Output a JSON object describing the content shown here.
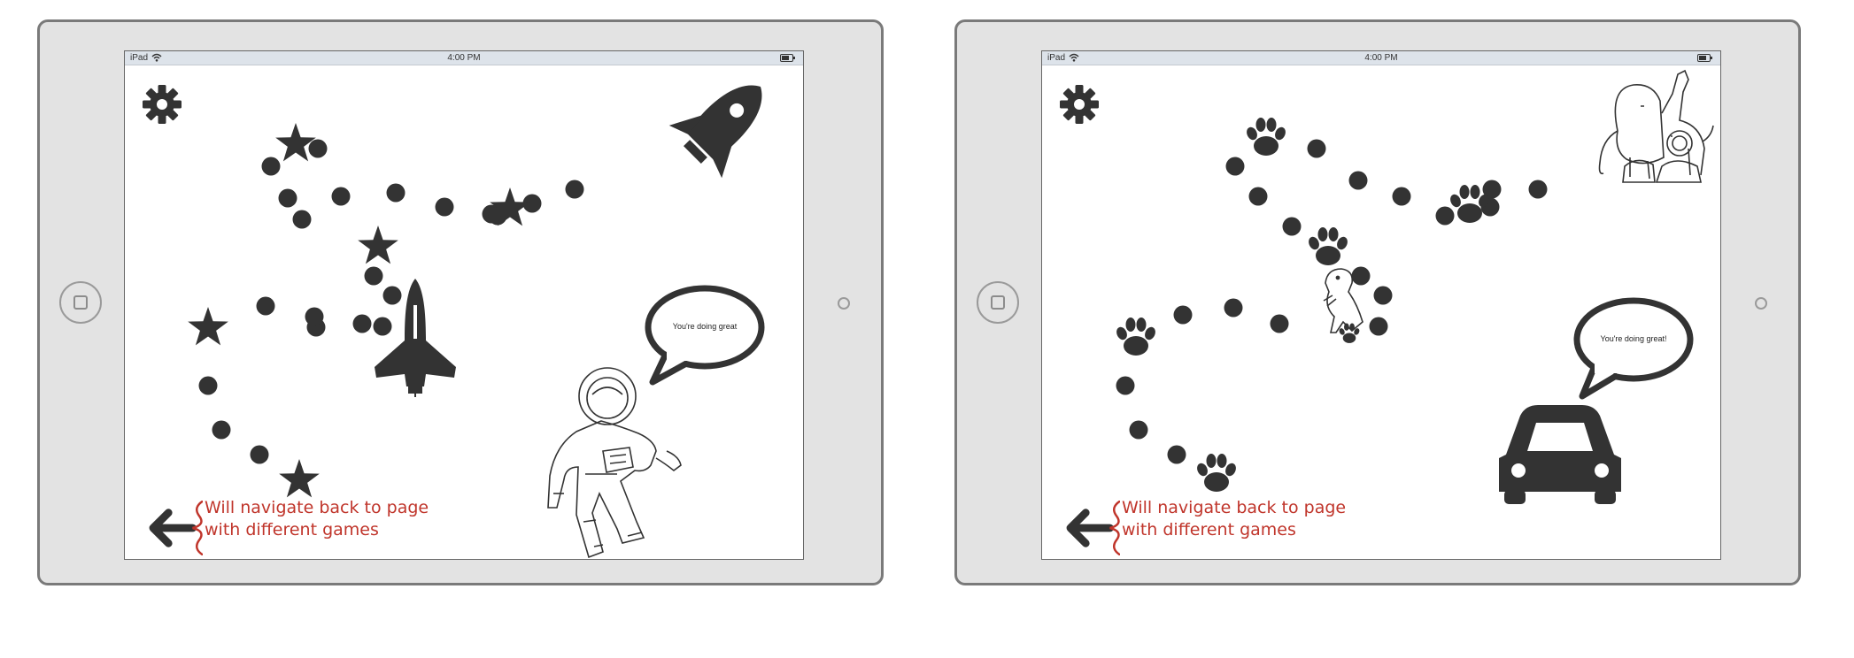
{
  "screens": [
    {
      "status": {
        "carrier": "iPad",
        "time": "4:00 PM"
      },
      "theme": "space",
      "annotation": [
        "Will navigate back to page",
        "with different games"
      ],
      "bubble_text": "You're doing great"
    },
    {
      "status": {
        "carrier": "iPad",
        "time": "4:00 PM"
      },
      "theme": "animals",
      "annotation": [
        "Will navigate back to page",
        "with different games"
      ],
      "bubble_text": "You're doing great!"
    }
  ],
  "colors": {
    "ink": "#333333",
    "annotation": "#c0352b",
    "bezel": "#e3e3e3",
    "status_bar": "#dde3ea"
  }
}
